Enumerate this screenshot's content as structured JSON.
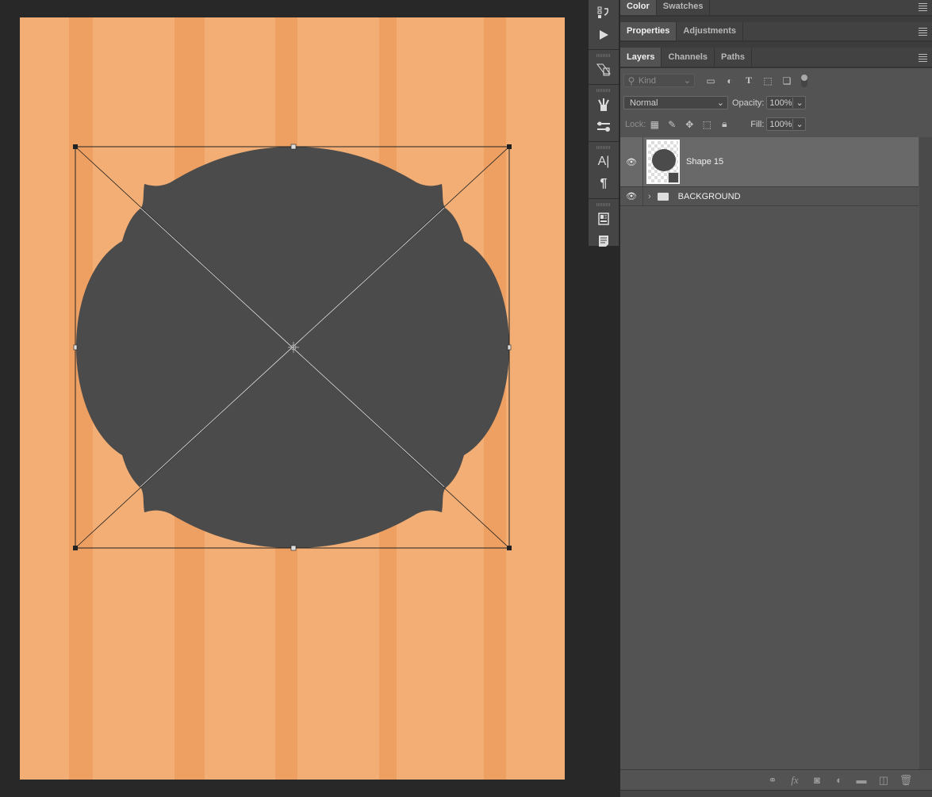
{
  "document": {
    "background_color": "#f2ae74",
    "stripe_color": "#eea063",
    "shape_color": "#4b4b4b",
    "layer_name_selected": "Shape 15"
  },
  "tool_strip": {
    "groups": [
      [
        "history-icon",
        "play-actions-icon"
      ],
      [
        "clone-source-icon"
      ],
      [
        "brushes-icon",
        "brush-settings-icon"
      ],
      [
        "character-icon",
        "paragraph-icon"
      ],
      [
        "character-styles-icon",
        "paragraph-styles-icon"
      ]
    ]
  },
  "panels": {
    "top": {
      "tabs": [
        "Color",
        "Swatches"
      ],
      "active": "Color"
    },
    "middle": {
      "tabs": [
        "Properties",
        "Adjustments"
      ],
      "active": "Properties"
    },
    "layers": {
      "tabs": [
        "Layers",
        "Channels",
        "Paths"
      ],
      "active": "Layers"
    }
  },
  "layers_panel": {
    "filter": {
      "placeholder": "Kind",
      "icons": [
        "image-filter-icon",
        "adjustment-filter-icon",
        "type-filter-icon",
        "shape-filter-icon",
        "smart-object-filter-icon",
        "filter-toggle-icon"
      ]
    },
    "blend_mode": "Normal",
    "opacity_label": "Opacity:",
    "opacity_value": "100%",
    "lock_label": "Lock:",
    "lock_icons": [
      "lock-transparent-icon",
      "lock-image-icon",
      "lock-position-icon",
      "lock-artboard-icon",
      "lock-all-icon"
    ],
    "fill_label": "Fill:",
    "fill_value": "100%",
    "layers": [
      {
        "name": "Shape 15",
        "visible": true,
        "selected": true,
        "type": "smart-object"
      },
      {
        "name": "BACKGROUND",
        "visible": true,
        "selected": false,
        "type": "group"
      }
    ],
    "footer_icons": [
      "link-layers-icon",
      "fx-icon",
      "add-mask-icon",
      "new-adjustment-icon",
      "new-group-icon",
      "new-layer-icon",
      "delete-layer-icon"
    ]
  }
}
